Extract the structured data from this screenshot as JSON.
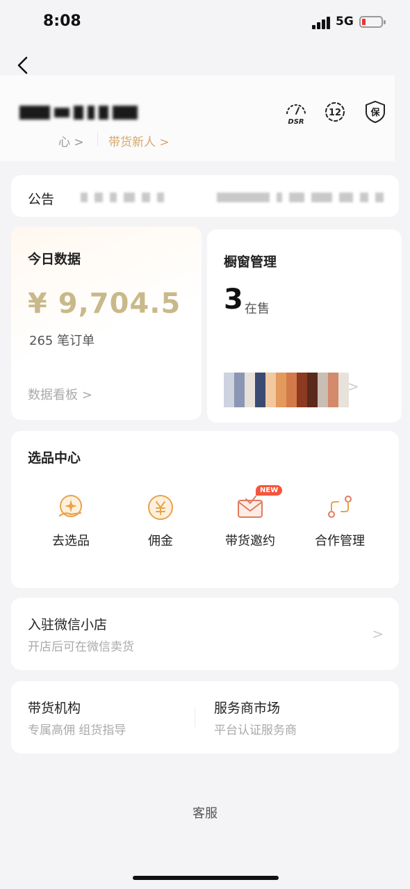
{
  "status_bar": {
    "time": "8:08",
    "network": "5G"
  },
  "profile": {
    "center_link": "心 >",
    "tag_link": "带货新人 >",
    "icons": {
      "dsr_label": "DSR",
      "level_label": "12",
      "guarantee_label": "保"
    }
  },
  "notice": {
    "title": "公告"
  },
  "today": {
    "title": "今日数据",
    "amount": "¥ 9,704.5",
    "orders": "265 笔订单",
    "dashboard_link": "数据看板 >"
  },
  "window_mgmt": {
    "title": "橱窗管理",
    "count": "3",
    "count_suffix": "在售",
    "arrow": ">"
  },
  "selection_center": {
    "title": "选品中心",
    "tools": [
      {
        "label": "去选品",
        "icon": "sparkle-hand-icon"
      },
      {
        "label": "佣金",
        "icon": "yen-coin-icon"
      },
      {
        "label": "带货邀约",
        "icon": "envelope-icon",
        "badge": "NEW"
      },
      {
        "label": "合作管理",
        "icon": "cooperation-icon"
      }
    ]
  },
  "wechat_store": {
    "title": "入驻微信小店",
    "subtitle": "开店后可在微信卖货",
    "arrow": ">"
  },
  "organizations": {
    "left": {
      "title": "带货机构",
      "subtitle": "专属高佣 组货指导"
    },
    "right": {
      "title": "服务商市场",
      "subtitle": "平台认证服务商"
    }
  },
  "footer": {
    "service": "客服"
  },
  "colors": {
    "accent_gold": "#d7a86a",
    "amount_gold": "#c9b98a",
    "icon_orange": "#e8a24a",
    "badge_red": "#f5553d",
    "battery_low": "#e33333"
  }
}
